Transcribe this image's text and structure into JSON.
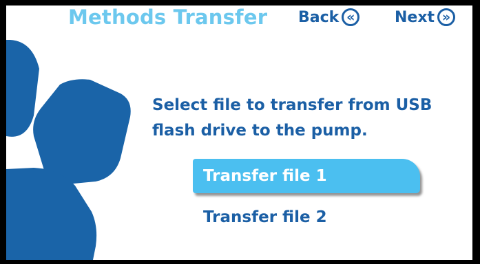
{
  "header": {
    "title": "Methods Transfer",
    "back_label": "Back",
    "next_label": "Next",
    "back_icon": "double-chevron-left-icon",
    "next_icon": "double-chevron-right-icon"
  },
  "main": {
    "prompt_line1": "Select file to transfer from USB",
    "prompt_line2": "flash drive to the pump.",
    "files": [
      {
        "label": "Transfer file 1",
        "selected": true
      },
      {
        "label": "Transfer file 2",
        "selected": false
      }
    ]
  },
  "colors": {
    "title": "#6cc8ee",
    "text": "#1b5fa5",
    "selected_bg": "#4bbff0",
    "petal": "#1a64a8"
  }
}
